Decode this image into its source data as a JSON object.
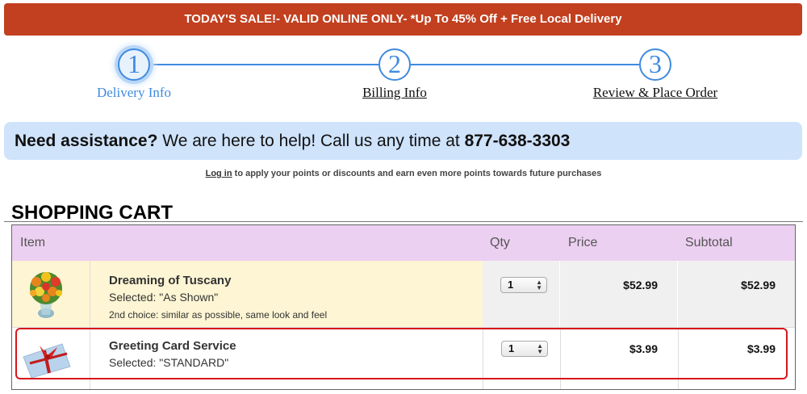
{
  "banner": {
    "text": "TODAY'S SALE!- VALID ONLINE ONLY-  *Up To 45% Off  + Free Local Delivery"
  },
  "steps": [
    {
      "number": "1",
      "label": "Delivery Info",
      "state": "active"
    },
    {
      "number": "2",
      "label": "Billing Info",
      "state": "link"
    },
    {
      "number": "3",
      "label": "Review & Place Order",
      "state": "link"
    }
  ],
  "assist": {
    "lead": "Need assistance?",
    "text": " We are here to help! Call us any time at ",
    "phone": "877-638-3303"
  },
  "login": {
    "link": "Log in",
    "text": " to apply your points or discounts and earn even more points towards future purchases"
  },
  "cart": {
    "title": "SHOPPING CART",
    "headers": {
      "item": "Item",
      "qty": "Qty",
      "price": "Price",
      "subtotal": "Subtotal"
    },
    "rows": [
      {
        "image": "flower-bouquet-image",
        "name": "Dreaming of Tuscany",
        "selected": "Selected: \"As Shown\"",
        "note": "2nd choice: similar as possible, same look and feel",
        "qty": "1",
        "price": "$52.99",
        "subtotal": "$52.99"
      },
      {
        "image": "greeting-card-image",
        "name": "Greeting Card Service",
        "selected": "Selected: \"STANDARD\"",
        "qty": "1",
        "price": "$3.99",
        "subtotal": "$3.99"
      }
    ]
  },
  "colors": {
    "banner_bg": "#c2401f",
    "step_accent": "#3f8ae0",
    "assist_bg": "#cfe3fb",
    "cart_header_bg": "#ecd0f1",
    "row_highlight_bg": "#fdf5d4",
    "highlight_border": "#d8161b"
  }
}
